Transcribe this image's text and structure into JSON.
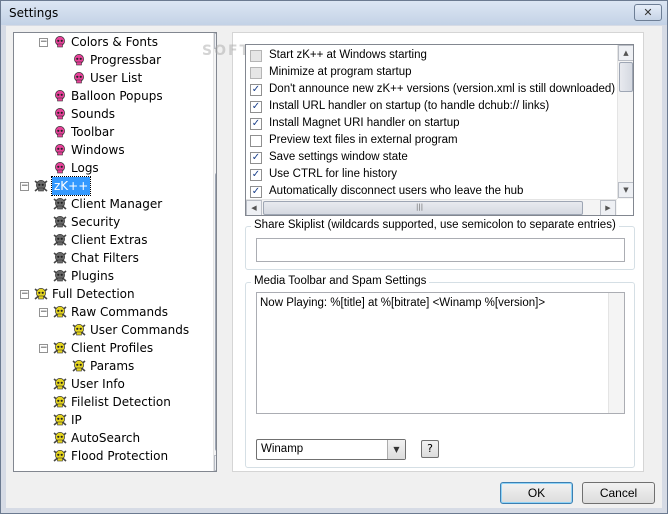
{
  "window": {
    "title": "Settings",
    "close_glyph": "✕"
  },
  "tree": {
    "items": [
      {
        "label": "Colors & Fonts",
        "icon": "pink-skull-icon",
        "expander": "−"
      },
      {
        "label": "Progressbar",
        "icon": "pink-skull-icon"
      },
      {
        "label": "User List",
        "icon": "pink-skull-icon"
      },
      {
        "label": "Balloon Popups",
        "icon": "pink-skull-icon"
      },
      {
        "label": "Sounds",
        "icon": "pink-skull-icon"
      },
      {
        "label": "Toolbar",
        "icon": "pink-skull-icon"
      },
      {
        "label": "Windows",
        "icon": "pink-skull-icon"
      },
      {
        "label": "Logs",
        "icon": "pink-skull-icon"
      },
      {
        "label": "zK++",
        "icon": "skull-crossbones-icon",
        "expander": "−",
        "selected": true
      },
      {
        "label": "Client Manager",
        "icon": "skull-crossbones-icon"
      },
      {
        "label": "Security",
        "icon": "skull-crossbones-icon"
      },
      {
        "label": "Client Extras",
        "icon": "skull-crossbones-icon"
      },
      {
        "label": "Chat Filters",
        "icon": "skull-crossbones-icon"
      },
      {
        "label": "Plugins",
        "icon": "skull-crossbones-icon"
      },
      {
        "label": "Full Detection",
        "icon": "yellow-skull-icon",
        "expander": "−"
      },
      {
        "label": "Raw Commands",
        "icon": "yellow-skull-icon",
        "expander": "−"
      },
      {
        "label": "User Commands",
        "icon": "yellow-skull-icon"
      },
      {
        "label": "Client Profiles",
        "icon": "yellow-skull-icon",
        "expander": "−"
      },
      {
        "label": "Params",
        "icon": "yellow-skull-icon"
      },
      {
        "label": "User Info",
        "icon": "yellow-skull-icon"
      },
      {
        "label": "Filelist Detection",
        "icon": "yellow-skull-icon"
      },
      {
        "label": "IP",
        "icon": "yellow-skull-icon"
      },
      {
        "label": "AutoSearch",
        "icon": "yellow-skull-icon"
      },
      {
        "label": "Flood Protection",
        "icon": "yellow-skull-icon"
      }
    ]
  },
  "options": [
    {
      "label": "Start zK++ at Windows starting",
      "checked": false,
      "disabled": true
    },
    {
      "label": "Minimize at program startup",
      "checked": false,
      "disabled": true
    },
    {
      "label": "Don't announce new zK++ versions (version.xml is still downloaded)",
      "checked": true
    },
    {
      "label": "Install URL handler on startup (to handle dchub:// links)",
      "checked": true
    },
    {
      "label": "Install Magnet URI handler on startup",
      "checked": true
    },
    {
      "label": "Preview text files in external program",
      "checked": false
    },
    {
      "label": "Save settings window state",
      "checked": true
    },
    {
      "label": "Use CTRL for line history",
      "checked": true
    },
    {
      "label": "Automatically disconnect users who leave the hub",
      "checked": true
    }
  ],
  "skiplist": {
    "title": "Share Skiplist (wildcards supported, use semicolon to separate entries)",
    "value": ""
  },
  "media": {
    "title": "Media Toolbar and Spam Settings",
    "spam_text": "Now Playing: %[title] at %[bitrate] <Winamp %[version]>",
    "player": "Winamp",
    "help_label": "?"
  },
  "buttons": {
    "ok": "OK",
    "cancel": "Cancel"
  },
  "glyphs": {
    "check": "✓",
    "up": "▲",
    "down": "▼",
    "left": "◀",
    "right": "▶",
    "dropdown": "▼",
    "grip": "≡",
    "hgrip": "|||"
  },
  "watermark": "SOFTPEDIA",
  "colors": {
    "selection": "#3399ff",
    "pink_skull": "#e8419a",
    "yellow_skull": "#e5d51f",
    "gray_skull": "#6a6a6a"
  }
}
